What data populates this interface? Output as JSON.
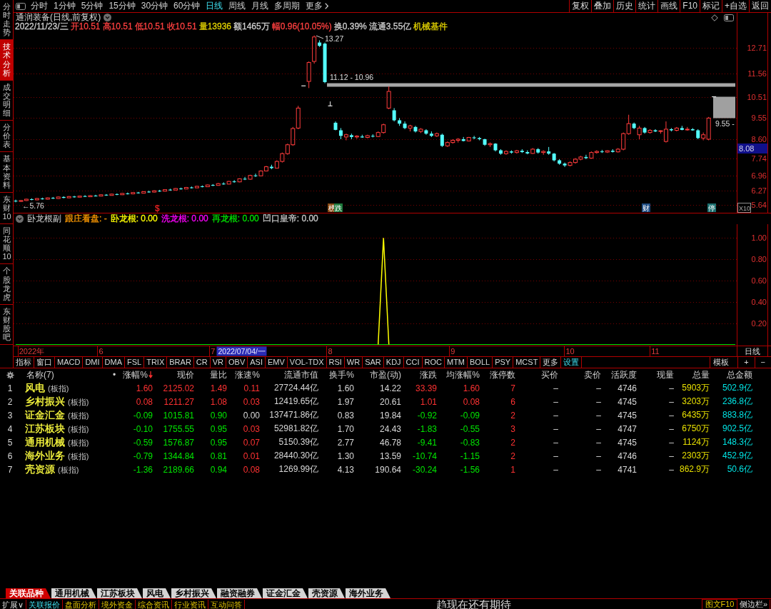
{
  "sidebar": {
    "tabs": [
      {
        "label": "分时走势",
        "selected": false
      },
      {
        "label": "技术分析",
        "selected": true
      },
      {
        "label": "成交明细",
        "selected": false
      },
      {
        "label": "分价表",
        "selected": false
      },
      {
        "label": "基本资料",
        "selected": false
      },
      {
        "label": "东财10",
        "selected": false
      },
      {
        "label": "同花顺10",
        "selected": false
      },
      {
        "label": "个股龙虎",
        "selected": false
      },
      {
        "label": "东财股吧",
        "selected": false
      }
    ]
  },
  "toolbar": {
    "periods": [
      {
        "label": "分时",
        "selected": false
      },
      {
        "label": "1分钟",
        "selected": false
      },
      {
        "label": "5分钟",
        "selected": false
      },
      {
        "label": "15分钟",
        "selected": false
      },
      {
        "label": "30分钟",
        "selected": false
      },
      {
        "label": "60分钟",
        "selected": false
      },
      {
        "label": "日线",
        "selected": true
      },
      {
        "label": "周线",
        "selected": false
      },
      {
        "label": "月线",
        "selected": false
      },
      {
        "label": "多周期",
        "selected": false
      }
    ],
    "more": "更多",
    "actions": [
      "复权",
      "叠加",
      "历史",
      "统计",
      "画线",
      "F10",
      "标记",
      "+自选",
      "返回"
    ]
  },
  "price_chart": {
    "title": "通润装备(日线,前复权)",
    "quote": [
      {
        "text": "2022/11/23/三",
        "color": "#d0d0d0"
      },
      {
        "text": "开10.51",
        "color": "#ff4040"
      },
      {
        "text": "高10.51",
        "color": "#ff4040"
      },
      {
        "text": "低10.51",
        "color": "#ff4040"
      },
      {
        "text": "收10.51",
        "color": "#ff4040"
      },
      {
        "text": "量13936",
        "color": "#e0d000"
      },
      {
        "text": "额1465万",
        "color": "#d0d0d0"
      },
      {
        "text": "幅0.96(10.05%)",
        "color": "#ff4040"
      },
      {
        "text": "换0.39%",
        "color": "#d0d0d0"
      },
      {
        "text": "流通3.55亿",
        "color": "#d0d0d0"
      },
      {
        "text": "机械基件",
        "color": "#e0d000"
      }
    ],
    "chart_data": {
      "type": "candlestick",
      "grid": true,
      "categories": [
        null,
        null,
        null,
        null,
        null,
        null,
        null,
        null,
        null,
        null,
        null,
        null,
        null,
        null,
        null,
        null,
        null,
        null,
        null,
        null,
        null,
        null,
        null,
        null,
        null,
        null,
        null,
        null,
        null,
        null,
        null,
        null,
        null,
        null,
        null,
        null,
        null,
        null,
        null,
        null,
        null,
        null,
        null,
        null,
        null,
        null,
        null,
        null,
        null,
        null,
        null,
        null,
        null,
        null,
        null,
        null,
        null,
        null,
        null,
        null,
        null,
        null,
        null,
        null,
        null,
        null,
        null,
        null,
        null,
        null,
        null,
        null,
        null,
        null,
        null,
        null,
        null,
        null,
        null,
        null,
        null,
        null,
        null,
        null,
        null,
        null,
        null,
        null,
        null,
        null,
        null,
        null,
        null,
        null,
        null,
        null,
        null,
        null,
        null,
        null,
        null,
        null,
        null,
        null,
        null,
        null,
        null,
        null,
        null,
        null,
        null,
        null,
        null,
        null,
        null,
        null,
        null,
        null,
        null,
        null,
        null,
        null,
        null,
        null,
        null,
        null,
        null,
        null,
        null,
        null,
        null,
        null,
        null,
        null,
        null,
        null
      ],
      "ylim": [
        5.29,
        13.45
      ],
      "yticks": [
        {
          "value": 12.71,
          "label": "12.71"
        },
        {
          "value": 11.56,
          "label": "11.56"
        },
        {
          "value": 10.51,
          "label": "10.51"
        },
        {
          "value": 9.55,
          "label": "9.55"
        },
        {
          "value": 8.6,
          "label": "8.60"
        },
        {
          "value": 7.74,
          "label": "7.74"
        },
        {
          "value": 6.96,
          "label": "6.96"
        },
        {
          "value": 6.27,
          "label": "6.27"
        },
        {
          "value": 5.64,
          "label": "5.64"
        }
      ],
      "ohlc": [
        [
          5.83,
          5.88,
          5.76,
          5.8
        ],
        [
          5.8,
          5.86,
          5.78,
          5.84
        ],
        [
          5.84,
          5.92,
          5.82,
          5.9
        ],
        [
          5.9,
          5.94,
          5.85,
          5.87
        ],
        [
          5.87,
          5.95,
          5.85,
          5.93
        ],
        [
          5.93,
          5.97,
          5.88,
          5.9
        ],
        [
          5.9,
          5.98,
          5.88,
          5.96
        ],
        [
          5.96,
          6.0,
          5.91,
          5.93
        ],
        [
          5.93,
          6.02,
          5.92,
          6.0
        ],
        [
          6.0,
          6.03,
          5.94,
          5.96
        ],
        [
          5.96,
          6.04,
          5.95,
          6.02
        ],
        [
          6.02,
          6.05,
          5.97,
          5.99
        ],
        [
          5.99,
          6.06,
          5.98,
          6.04
        ],
        [
          6.04,
          6.08,
          6.0,
          6.01
        ],
        [
          6.01,
          6.08,
          6.0,
          6.06
        ],
        [
          6.06,
          6.1,
          6.02,
          6.04
        ],
        [
          6.04,
          6.12,
          6.03,
          6.1
        ],
        [
          6.1,
          6.13,
          6.05,
          6.07
        ],
        [
          6.07,
          6.15,
          6.06,
          6.13
        ],
        [
          6.13,
          6.16,
          6.08,
          6.1
        ],
        [
          6.1,
          6.18,
          6.09,
          6.16
        ],
        [
          6.16,
          6.2,
          6.11,
          6.14
        ],
        [
          6.14,
          6.22,
          6.12,
          6.2
        ],
        [
          6.2,
          6.23,
          6.15,
          6.17
        ],
        [
          6.17,
          6.26,
          6.16,
          6.24
        ],
        [
          6.24,
          6.28,
          6.19,
          6.22
        ],
        [
          6.22,
          6.3,
          6.2,
          6.28
        ],
        [
          6.28,
          6.32,
          6.23,
          6.26
        ],
        [
          6.26,
          6.35,
          6.25,
          6.33
        ],
        [
          6.33,
          6.37,
          6.28,
          6.31
        ],
        [
          6.31,
          6.4,
          6.3,
          6.38
        ],
        [
          6.38,
          6.42,
          6.33,
          6.36
        ],
        [
          6.36,
          6.45,
          6.35,
          6.43
        ],
        [
          6.43,
          6.47,
          6.38,
          6.41
        ],
        [
          6.41,
          6.5,
          6.4,
          6.48
        ],
        [
          6.48,
          6.52,
          6.43,
          6.46
        ],
        [
          6.46,
          6.56,
          6.45,
          6.54
        ],
        [
          6.54,
          6.58,
          6.49,
          6.52
        ],
        [
          6.52,
          6.63,
          6.51,
          6.6
        ],
        [
          6.6,
          6.66,
          6.55,
          6.58
        ],
        [
          6.58,
          6.72,
          6.57,
          6.7
        ],
        [
          6.7,
          6.76,
          6.64,
          6.68
        ],
        [
          6.68,
          6.84,
          6.66,
          6.82
        ],
        [
          6.82,
          6.9,
          6.76,
          6.8
        ],
        [
          6.8,
          7.0,
          6.78,
          6.97
        ],
        [
          6.97,
          7.05,
          6.9,
          6.95
        ],
        [
          6.95,
          7.2,
          6.93,
          7.17
        ],
        [
          7.17,
          7.4,
          7.15,
          7.36
        ],
        [
          7.36,
          7.45,
          7.25,
          7.3
        ],
        [
          7.3,
          7.65,
          7.28,
          7.6
        ],
        [
          7.6,
          8.0,
          7.55,
          7.95
        ],
        [
          7.95,
          8.4,
          7.9,
          8.35
        ],
        [
          8.35,
          9.15,
          8.3,
          9.08
        ],
        [
          9.1,
          10.1,
          9.05,
          10.0
        ],
        [
          11.0,
          11.0,
          11.0,
          11.0
        ],
        [
          11.2,
          12.1,
          10.9,
          12.05
        ],
        [
          12.1,
          13.27,
          12.0,
          13.2
        ],
        [
          12.95,
          13.05,
          12.75,
          12.8
        ],
        [
          12.9,
          12.95,
          11.12,
          11.17
        ],
        [
          10.1,
          10.3,
          10.1,
          10.1
        ],
        [
          9.34,
          9.4,
          9.0,
          9.02
        ],
        [
          9.0,
          9.1,
          8.6,
          8.75
        ],
        [
          8.7,
          8.85,
          8.55,
          8.8
        ],
        [
          8.78,
          8.85,
          8.6,
          8.7
        ],
        [
          8.7,
          8.78,
          8.62,
          8.74
        ],
        [
          8.72,
          8.8,
          8.66,
          8.68
        ],
        [
          8.68,
          8.8,
          8.64,
          8.76
        ],
        [
          8.75,
          8.82,
          8.68,
          8.72
        ],
        [
          8.72,
          8.95,
          8.7,
          8.9
        ],
        [
          8.9,
          9.3,
          8.85,
          9.25
        ],
        [
          10.0,
          10.98,
          9.95,
          10.75
        ],
        [
          9.9,
          10.0,
          9.4,
          9.45
        ],
        [
          9.45,
          9.55,
          9.2,
          9.3
        ],
        [
          9.3,
          9.4,
          9.05,
          9.1
        ],
        [
          9.1,
          9.25,
          8.95,
          9.2
        ],
        [
          9.15,
          9.2,
          8.9,
          8.95
        ],
        [
          8.95,
          9.1,
          8.88,
          9.05
        ],
        [
          9.0,
          9.05,
          8.8,
          8.85
        ],
        [
          8.85,
          8.95,
          8.7,
          8.75
        ],
        [
          8.75,
          8.9,
          8.7,
          8.85
        ],
        [
          8.8,
          8.85,
          8.25,
          8.3
        ],
        [
          8.3,
          8.5,
          8.25,
          8.45
        ],
        [
          8.45,
          8.6,
          8.4,
          8.55
        ],
        [
          8.55,
          8.65,
          8.45,
          8.6
        ],
        [
          8.6,
          8.7,
          8.5,
          8.52
        ],
        [
          8.52,
          8.7,
          8.5,
          8.68
        ],
        [
          8.68,
          8.75,
          8.6,
          8.65
        ],
        [
          8.65,
          8.7,
          8.55,
          8.6
        ],
        [
          8.6,
          8.62,
          8.3,
          8.35
        ],
        [
          8.35,
          8.45,
          8.25,
          8.4
        ],
        [
          8.4,
          8.42,
          8.05,
          8.1
        ],
        [
          8.1,
          8.15,
          7.9,
          7.95
        ],
        [
          7.95,
          8.1,
          7.9,
          8.05
        ],
        [
          8.05,
          8.1,
          7.95,
          8.0
        ],
        [
          8.0,
          8.12,
          7.95,
          8.08
        ],
        [
          8.08,
          8.15,
          7.98,
          8.02
        ],
        [
          8.02,
          8.1,
          7.92,
          7.96
        ],
        [
          7.96,
          8.2,
          7.94,
          8.15
        ],
        [
          8.15,
          8.2,
          7.95,
          8.0
        ],
        [
          8.0,
          8.1,
          7.9,
          8.05
        ],
        [
          8.05,
          8.25,
          7.9,
          7.95
        ],
        [
          7.95,
          7.98,
          7.6,
          7.65
        ],
        [
          7.65,
          7.7,
          7.45,
          7.5
        ],
        [
          7.5,
          7.55,
          7.35,
          7.42
        ],
        [
          7.42,
          7.6,
          7.38,
          7.55
        ],
        [
          7.55,
          7.75,
          7.5,
          7.7
        ],
        [
          7.7,
          7.85,
          7.65,
          7.8
        ],
        [
          7.8,
          7.9,
          7.7,
          7.75
        ],
        [
          7.75,
          8.05,
          7.72,
          8.0
        ],
        [
          8.0,
          8.1,
          7.95,
          8.05
        ],
        [
          8.05,
          8.12,
          7.98,
          8.02
        ],
        [
          8.02,
          8.1,
          7.98,
          8.08
        ],
        [
          8.08,
          8.15,
          8.0,
          8.03
        ],
        [
          8.03,
          8.2,
          8.0,
          8.15
        ],
        [
          8.15,
          8.9,
          8.1,
          8.85
        ],
        [
          8.85,
          9.7,
          8.8,
          9.3
        ],
        [
          9.3,
          9.35,
          9.05,
          9.1
        ],
        [
          8.8,
          9.2,
          8.6,
          9.1
        ],
        [
          9.1,
          9.15,
          8.85,
          8.9
        ],
        [
          8.9,
          9.05,
          8.85,
          9.0
        ],
        [
          9.0,
          9.05,
          8.92,
          8.95
        ],
        [
          8.95,
          9.0,
          8.85,
          8.98
        ],
        [
          8.5,
          9.4,
          8.45,
          9.05
        ],
        [
          9.05,
          9.1,
          8.95,
          9.0
        ],
        [
          9.0,
          9.15,
          8.95,
          9.1
        ],
        [
          9.1,
          9.2,
          9.0,
          9.02
        ],
        [
          9.02,
          9.15,
          8.98,
          9.05
        ],
        [
          9.05,
          9.1,
          8.98,
          9.0
        ],
        [
          9.0,
          9.05,
          8.6,
          8.65
        ],
        [
          8.65,
          8.9,
          8.55,
          8.8
        ],
        [
          8.6,
          9.6,
          8.55,
          9.55
        ],
        [
          10.51,
          10.51,
          10.51,
          10.51
        ],
        null,
        null,
        null,
        null
      ],
      "bands": [
        {
          "axis": "y",
          "from": 10.96,
          "to": 11.12,
          "label": "11.12 - 10.96"
        }
      ]
    },
    "gap_box": {
      "label": "9.55 -"
    },
    "high_label": "13.27",
    "low_label": "←5.76",
    "price_tag": "8.08",
    "scale_button": "X10",
    "event_tags": [
      {
        "text": "$",
        "kind": "glyph",
        "color": "#e02020"
      },
      {
        "text": "榜",
        "kind": "badge",
        "color": "#8a4a14"
      },
      {
        "text": "跌",
        "kind": "badge",
        "color": "#1e7a3c"
      },
      {
        "text": "财",
        "kind": "badge",
        "color": "#1c4a80"
      },
      {
        "text": "停",
        "kind": "badge",
        "color": "#1c7070"
      }
    ]
  },
  "indicator": {
    "name": "卧龙根副",
    "readouts": [
      {
        "text": "跟庄看盘: -",
        "color": "#ff9a00"
      },
      {
        "text": "卧龙根: 0.00",
        "color": "#ffff00"
      },
      {
        "text": "洗龙根: 0.00",
        "color": "#ff00ff"
      },
      {
        "text": "再龙根: 0.00",
        "color": "#00e000"
      },
      {
        "text": "凹口皇帝: 0.00",
        "color": "#c8c8c8"
      }
    ],
    "chart_data": {
      "type": "line",
      "grid": true,
      "categories": [
        null,
        null,
        null,
        "2022年",
        null,
        null,
        null,
        null,
        null,
        null,
        null,
        null,
        null,
        null,
        null,
        null,
        "6",
        null,
        null,
        null,
        null,
        null,
        null,
        null,
        null,
        null,
        null,
        null,
        null,
        null,
        null,
        null,
        null,
        null,
        null,
        null,
        null,
        "7",
        null,
        null,
        null,
        null,
        null,
        null,
        null,
        null,
        null,
        null,
        null,
        null,
        null,
        null,
        null,
        null,
        null,
        null,
        null,
        null,
        null,
        "8",
        null,
        null,
        null,
        null,
        null,
        null,
        null,
        null,
        null,
        null,
        null,
        null,
        null,
        null,
        null,
        null,
        null,
        null,
        null,
        null,
        null,
        null,
        "9",
        null,
        null,
        null,
        null,
        null,
        null,
        null,
        null,
        null,
        null,
        null,
        null,
        null,
        null,
        null,
        null,
        null,
        null,
        null,
        null,
        null,
        "10",
        null,
        null,
        null,
        null,
        null,
        null,
        null,
        null,
        null,
        null,
        null,
        null,
        null,
        null,
        null,
        "11",
        null,
        null,
        null,
        null,
        null,
        null,
        null,
        null,
        null,
        null,
        null,
        null,
        null,
        null,
        null
      ],
      "ylim": [
        0,
        1.12
      ],
      "yticks": [
        {
          "value": 1,
          "label": "1.00"
        },
        {
          "value": 0.8,
          "label": "0.80"
        },
        {
          "value": 0.6,
          "label": "0.60"
        },
        {
          "value": 0.4,
          "label": "0.40"
        },
        {
          "value": 0.2,
          "label": "0.20"
        }
      ],
      "series": [
        {
          "color": "#00e000",
          "values": [
            0,
            0,
            0,
            0,
            0,
            0,
            0,
            0,
            0,
            0,
            0,
            0,
            0,
            0,
            0,
            0,
            0,
            0,
            0,
            0,
            0,
            0,
            0,
            0,
            0,
            0,
            0,
            0,
            0,
            0,
            0,
            0,
            0,
            0,
            0,
            0,
            0,
            0,
            0,
            0,
            0,
            0,
            0,
            0,
            0,
            0,
            0,
            0,
            0,
            0,
            0,
            0,
            0,
            0,
            0,
            0,
            0,
            0,
            0,
            0,
            0,
            0,
            0,
            0,
            0,
            0,
            0,
            0,
            0,
            0,
            0,
            0,
            0,
            0,
            0,
            0,
            0,
            0,
            0,
            0,
            0,
            0,
            0,
            0,
            0,
            0,
            0,
            0,
            0,
            0,
            0,
            0,
            0,
            0,
            0,
            0,
            0,
            0,
            0,
            0,
            0,
            0,
            0,
            0,
            0,
            0,
            0,
            0,
            0,
            0,
            0,
            0,
            0,
            0,
            0,
            0,
            0,
            0,
            0,
            0,
            0,
            0,
            0,
            0,
            0,
            0,
            0,
            0,
            0,
            0,
            0,
            0,
            0,
            0,
            0,
            0
          ]
        },
        {
          "color": "#ffff00",
          "values": [
            null,
            null,
            null,
            null,
            null,
            null,
            null,
            null,
            null,
            null,
            null,
            null,
            null,
            null,
            null,
            null,
            null,
            null,
            null,
            null,
            null,
            null,
            null,
            null,
            null,
            null,
            null,
            null,
            null,
            null,
            null,
            null,
            null,
            null,
            null,
            null,
            null,
            null,
            null,
            null,
            null,
            null,
            null,
            null,
            null,
            null,
            null,
            null,
            null,
            null,
            null,
            null,
            null,
            null,
            null,
            null,
            null,
            null,
            null,
            null,
            null,
            null,
            null,
            null,
            null,
            null,
            null,
            null,
            0,
            1,
            0,
            null,
            null,
            null,
            null,
            null,
            null,
            null,
            null,
            null,
            null,
            null,
            null,
            null,
            null,
            null,
            null,
            null,
            null,
            null,
            null,
            null,
            null,
            null,
            null,
            null,
            null,
            null,
            null,
            null,
            null,
            null,
            null,
            null,
            null,
            null,
            null,
            null,
            null,
            null,
            null,
            null,
            null,
            null,
            null,
            null,
            null,
            null,
            null,
            null,
            null,
            null,
            null,
            null,
            null,
            null,
            null,
            null,
            null,
            null,
            null,
            null,
            null,
            null,
            null,
            null
          ]
        }
      ]
    },
    "cursor_date": "2022/07/04/一",
    "period_label": "日线"
  },
  "indicator_tabs": {
    "items": [
      {
        "label": "指标",
        "kind": "tab"
      },
      {
        "label": "窗口",
        "kind": "tab"
      },
      {
        "label": "MACD",
        "kind": "tab"
      },
      {
        "label": "DMI",
        "kind": "tab"
      },
      {
        "label": "DMA",
        "kind": "tab"
      },
      {
        "label": "FSL",
        "kind": "tab"
      },
      {
        "label": "TRIX",
        "kind": "tab"
      },
      {
        "label": "BRAR",
        "kind": "tab"
      },
      {
        "label": "CR",
        "kind": "tab"
      },
      {
        "label": "VR",
        "kind": "tab"
      },
      {
        "label": "OBV",
        "kind": "tab"
      },
      {
        "label": "ASI",
        "kind": "tab"
      },
      {
        "label": "EMV",
        "kind": "tab"
      },
      {
        "label": "VOL-TDX",
        "kind": "tab"
      },
      {
        "label": "RSI",
        "kind": "tab"
      },
      {
        "label": "WR",
        "kind": "tab"
      },
      {
        "label": "SAR",
        "kind": "tab"
      },
      {
        "label": "KDJ",
        "kind": "tab"
      },
      {
        "label": "CCI",
        "kind": "tab"
      },
      {
        "label": "ROC",
        "kind": "tab"
      },
      {
        "label": "MTM",
        "kind": "tab"
      },
      {
        "label": "BOLL",
        "kind": "tab"
      },
      {
        "label": "PSY",
        "kind": "tab"
      },
      {
        "label": "MCST",
        "kind": "tab"
      },
      {
        "label": "更多",
        "kind": "tab"
      },
      {
        "label": "设置",
        "kind": "setting"
      }
    ],
    "buttons": [
      {
        "label": "模板",
        "kind": "template"
      },
      {
        "label": "+",
        "kind": "add"
      },
      {
        "label": "−",
        "kind": "remove"
      }
    ]
  },
  "table": {
    "columns": [
      {
        "label": "名称(7)",
        "kind": "name",
        "sorted": false
      },
      {
        "label": "•",
        "kind": "marker",
        "sorted": false
      },
      {
        "label": "涨幅%",
        "kind": "number",
        "sorted": true
      },
      {
        "label": "现价",
        "kind": "number",
        "sorted": false
      },
      {
        "label": "量比",
        "kind": "number",
        "sorted": false
      },
      {
        "label": "涨速%",
        "kind": "number",
        "sorted": false
      },
      {
        "label": "流通市值",
        "kind": "number",
        "sorted": false
      },
      {
        "label": "换手%",
        "kind": "number",
        "sorted": false
      },
      {
        "label": "市盈(动)",
        "kind": "number",
        "sorted": false
      },
      {
        "label": "涨跌",
        "kind": "number",
        "sorted": false
      },
      {
        "label": "均涨幅%",
        "kind": "number",
        "sorted": false
      },
      {
        "label": "涨停数",
        "kind": "number",
        "sorted": false
      },
      {
        "label": "买价",
        "kind": "number",
        "sorted": false
      },
      {
        "label": "卖价",
        "kind": "number",
        "sorted": false
      },
      {
        "label": "活跃度",
        "kind": "number",
        "sorted": false
      },
      {
        "label": "现量",
        "kind": "number",
        "sorted": false
      },
      {
        "label": "总量",
        "kind": "number",
        "sorted": false
      },
      {
        "label": "总金额",
        "kind": "number",
        "sorted": false
      }
    ],
    "rows": [
      {
        "index": "1",
        "cells": [
          {
            "text": "风电",
            "tag": "(板指)",
            "color": "#ffff40"
          },
          {
            "text": ""
          },
          {
            "text": "1.60",
            "color": "#ff3232"
          },
          {
            "text": "2125.02",
            "color": "#ff3232"
          },
          {
            "text": "1.49",
            "color": "#ff3232"
          },
          {
            "text": "0.11",
            "color": "#ff3232"
          },
          {
            "text": "27724.44亿",
            "color": "#d8d8d8"
          },
          {
            "text": "1.60",
            "color": "#d8d8d8"
          },
          {
            "text": "14.22",
            "color": "#d8d8d8"
          },
          {
            "text": "33.39",
            "color": "#ff3232"
          },
          {
            "text": "1.60",
            "color": "#ff3232"
          },
          {
            "text": "7",
            "color": "#ff3232"
          },
          {
            "text": "–"
          },
          {
            "text": "–"
          },
          {
            "text": "4746",
            "color": "#d8d8d8"
          },
          {
            "text": "–"
          },
          {
            "text": "5903万",
            "color": "#e8e000"
          },
          {
            "text": "502.9亿",
            "color": "#00e5e5"
          }
        ]
      },
      {
        "index": "2",
        "cells": [
          {
            "text": "乡村振兴",
            "tag": "(板指)",
            "color": "#ffff40"
          },
          {
            "text": ""
          },
          {
            "text": "0.08",
            "color": "#ff3232"
          },
          {
            "text": "1211.27",
            "color": "#ff3232"
          },
          {
            "text": "1.08",
            "color": "#ff3232"
          },
          {
            "text": "0.03",
            "color": "#ff3232"
          },
          {
            "text": "12419.65亿",
            "color": "#d8d8d8"
          },
          {
            "text": "1.97",
            "color": "#d8d8d8"
          },
          {
            "text": "20.61",
            "color": "#d8d8d8"
          },
          {
            "text": "1.01",
            "color": "#ff3232"
          },
          {
            "text": "0.08",
            "color": "#ff3232"
          },
          {
            "text": "6",
            "color": "#ff3232"
          },
          {
            "text": "–"
          },
          {
            "text": "–"
          },
          {
            "text": "4745",
            "color": "#d8d8d8"
          },
          {
            "text": "–"
          },
          {
            "text": "3203万",
            "color": "#e8e000"
          },
          {
            "text": "236.8亿",
            "color": "#00e5e5"
          }
        ]
      },
      {
        "index": "3",
        "cells": [
          {
            "text": "证金汇金",
            "tag": "(板指)",
            "color": "#ffff40"
          },
          {
            "text": ""
          },
          {
            "text": "-0.09",
            "color": "#00e600"
          },
          {
            "text": "1015.81",
            "color": "#00e600"
          },
          {
            "text": "0.90",
            "color": "#00e600"
          },
          {
            "text": "0.00",
            "color": "#d8d8d8"
          },
          {
            "text": "137471.86亿",
            "color": "#d8d8d8"
          },
          {
            "text": "0.83",
            "color": "#d8d8d8"
          },
          {
            "text": "19.84",
            "color": "#d8d8d8"
          },
          {
            "text": "-0.92",
            "color": "#00e600"
          },
          {
            "text": "-0.09",
            "color": "#00e600"
          },
          {
            "text": "2",
            "color": "#ff3232"
          },
          {
            "text": "–"
          },
          {
            "text": "–"
          },
          {
            "text": "4745",
            "color": "#d8d8d8"
          },
          {
            "text": "–"
          },
          {
            "text": "6435万",
            "color": "#e8e000"
          },
          {
            "text": "883.8亿",
            "color": "#00e5e5"
          }
        ]
      },
      {
        "index": "4",
        "cells": [
          {
            "text": "江苏板块",
            "tag": "(板指)",
            "color": "#ffff40"
          },
          {
            "text": ""
          },
          {
            "text": "-0.10",
            "color": "#00e600"
          },
          {
            "text": "1755.55",
            "color": "#00e600"
          },
          {
            "text": "0.95",
            "color": "#00e600"
          },
          {
            "text": "0.03",
            "color": "#ff3232"
          },
          {
            "text": "52981.82亿",
            "color": "#d8d8d8"
          },
          {
            "text": "1.70",
            "color": "#d8d8d8"
          },
          {
            "text": "24.43",
            "color": "#d8d8d8"
          },
          {
            "text": "-1.83",
            "color": "#00e600"
          },
          {
            "text": "-0.55",
            "color": "#00e600"
          },
          {
            "text": "3",
            "color": "#ff3232"
          },
          {
            "text": "–"
          },
          {
            "text": "–"
          },
          {
            "text": "4747",
            "color": "#d8d8d8"
          },
          {
            "text": "–"
          },
          {
            "text": "6750万",
            "color": "#e8e000"
          },
          {
            "text": "902.5亿",
            "color": "#00e5e5"
          }
        ]
      },
      {
        "index": "5",
        "cells": [
          {
            "text": "通用机械",
            "tag": "(板指)",
            "color": "#ffff40"
          },
          {
            "text": ""
          },
          {
            "text": "-0.59",
            "color": "#00e600"
          },
          {
            "text": "1576.87",
            "color": "#00e600"
          },
          {
            "text": "0.95",
            "color": "#00e600"
          },
          {
            "text": "0.07",
            "color": "#ff3232"
          },
          {
            "text": "5150.39亿",
            "color": "#d8d8d8"
          },
          {
            "text": "2.77",
            "color": "#d8d8d8"
          },
          {
            "text": "46.78",
            "color": "#d8d8d8"
          },
          {
            "text": "-9.41",
            "color": "#00e600"
          },
          {
            "text": "-0.83",
            "color": "#00e600"
          },
          {
            "text": "2",
            "color": "#ff3232"
          },
          {
            "text": "–"
          },
          {
            "text": "–"
          },
          {
            "text": "4745",
            "color": "#d8d8d8"
          },
          {
            "text": "–"
          },
          {
            "text": "1124万",
            "color": "#e8e000"
          },
          {
            "text": "148.3亿",
            "color": "#00e5e5"
          }
        ]
      },
      {
        "index": "6",
        "cells": [
          {
            "text": "海外业务",
            "tag": "(板指)",
            "color": "#ffff40"
          },
          {
            "text": ""
          },
          {
            "text": "-0.79",
            "color": "#00e600"
          },
          {
            "text": "1344.84",
            "color": "#00e600"
          },
          {
            "text": "0.81",
            "color": "#00e600"
          },
          {
            "text": "0.01",
            "color": "#ff3232"
          },
          {
            "text": "28440.30亿",
            "color": "#d8d8d8"
          },
          {
            "text": "1.30",
            "color": "#d8d8d8"
          },
          {
            "text": "13.59",
            "color": "#d8d8d8"
          },
          {
            "text": "-10.74",
            "color": "#00e600"
          },
          {
            "text": "-1.15",
            "color": "#00e600"
          },
          {
            "text": "2",
            "color": "#ff3232"
          },
          {
            "text": "–"
          },
          {
            "text": "–"
          },
          {
            "text": "4746",
            "color": "#d8d8d8"
          },
          {
            "text": "–"
          },
          {
            "text": "2303万",
            "color": "#e8e000"
          },
          {
            "text": "452.9亿",
            "color": "#00e5e5"
          }
        ]
      },
      {
        "index": "7",
        "cells": [
          {
            "text": "壳资源",
            "tag": "(板指)",
            "color": "#ffff40"
          },
          {
            "text": ""
          },
          {
            "text": "-1.36",
            "color": "#00e600"
          },
          {
            "text": "2189.66",
            "color": "#00e600"
          },
          {
            "text": "0.94",
            "color": "#00e600"
          },
          {
            "text": "0.08",
            "color": "#ff3232"
          },
          {
            "text": "1269.99亿",
            "color": "#d8d8d8"
          },
          {
            "text": "4.13",
            "color": "#d8d8d8"
          },
          {
            "text": "190.64",
            "color": "#d8d8d8"
          },
          {
            "text": "-30.24",
            "color": "#00e600"
          },
          {
            "text": "-1.56",
            "color": "#00e600"
          },
          {
            "text": "1",
            "color": "#ff3232"
          },
          {
            "text": "–"
          },
          {
            "text": "–"
          },
          {
            "text": "4741",
            "color": "#d8d8d8"
          },
          {
            "text": "–"
          },
          {
            "text": "862.9万",
            "color": "#e8e000"
          },
          {
            "text": "50.6亿",
            "color": "#00e5e5"
          }
        ]
      }
    ]
  },
  "sector_tabs": [
    {
      "label": "关联品种",
      "selected": true
    },
    {
      "label": "通用机械",
      "selected": false
    },
    {
      "label": "江苏板块",
      "selected": false
    },
    {
      "label": "风电",
      "selected": false
    },
    {
      "label": "乡村振兴",
      "selected": false
    },
    {
      "label": "融资融券",
      "selected": false
    },
    {
      "label": "证金汇金",
      "selected": false
    },
    {
      "label": "壳资源",
      "selected": false
    },
    {
      "label": "海外业务",
      "selected": false
    }
  ],
  "status_bar": {
    "items": [
      {
        "label": "扩展∨",
        "kind": "expand",
        "selected": false
      },
      {
        "label": "关联报价",
        "kind": "tab",
        "selected": true
      },
      {
        "label": "盘面分析",
        "kind": "tab",
        "selected": false
      },
      {
        "label": "境外资金",
        "kind": "tab",
        "selected": false
      },
      {
        "label": "综合资讯",
        "kind": "tab",
        "selected": false
      },
      {
        "label": "行业资讯",
        "kind": "tab",
        "selected": false
      },
      {
        "label": "互动问答",
        "kind": "tab",
        "selected": false
      }
    ],
    "ticker": "趋现在还有期待",
    "buttons": [
      {
        "label": "图文F10",
        "kind": "f10"
      },
      {
        "label": "侧边栏»",
        "kind": "sidebar"
      }
    ]
  }
}
